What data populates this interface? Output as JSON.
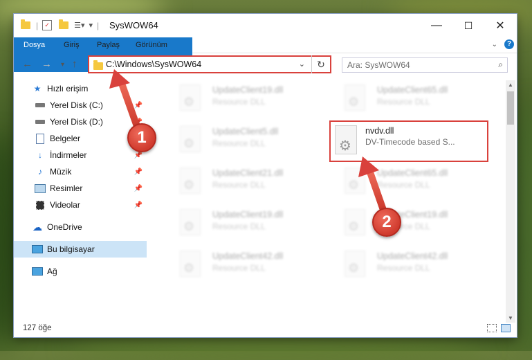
{
  "window": {
    "title": "SysWOW64",
    "minimize": "—",
    "maximize": "☐",
    "close": "✕"
  },
  "ribbon": {
    "tabs": [
      "Dosya",
      "Giriş",
      "Paylaş",
      "Görünüm"
    ],
    "help": "?"
  },
  "address": {
    "path": "C:\\Windows\\SysWOW64",
    "search_placeholder": "Ara: SysWOW64"
  },
  "sidebar": {
    "items": [
      {
        "label": "Hızlı erişim",
        "icon": "star-icon",
        "pinned": false
      },
      {
        "label": "Yerel Disk (C:)",
        "icon": "drive-icon",
        "pinned": true
      },
      {
        "label": "Yerel Disk (D:)",
        "icon": "drive-icon",
        "pinned": true
      },
      {
        "label": "Belgeler",
        "icon": "documents-icon",
        "pinned": true
      },
      {
        "label": "İndirmeler",
        "icon": "download-icon",
        "pinned": true
      },
      {
        "label": "Müzik",
        "icon": "music-icon",
        "pinned": true
      },
      {
        "label": "Resimler",
        "icon": "pictures-icon",
        "pinned": true
      },
      {
        "label": "Videolar",
        "icon": "videos-icon",
        "pinned": true
      },
      {
        "label": "OneDrive",
        "icon": "cloud-icon",
        "pinned": false
      },
      {
        "label": "Bu bilgisayar",
        "icon": "computer-icon",
        "pinned": false,
        "selected": true
      },
      {
        "label": "Ağ",
        "icon": "network-icon",
        "pinned": false
      }
    ]
  },
  "files": {
    "left": [
      {
        "name": "UpdateClient19.dll",
        "desc": "Resource DLL"
      },
      {
        "name": "UpdateClient5.dll",
        "desc": "Resource DLL"
      },
      {
        "name": "UpdateClient21.dll",
        "desc": "Resource DLL"
      },
      {
        "name": "UpdateClient19.dll",
        "desc": "Resource DLL"
      },
      {
        "name": "UpdateClient42.dll",
        "desc": "Resource DLL"
      }
    ],
    "right": [
      {
        "name": "UpdateClient65.dll",
        "desc": "Resource DLL"
      },
      {
        "name": "nvdv.dll",
        "desc": "DV-Timecode based S..."
      },
      {
        "name": "UpdateClient65.dll",
        "desc": "Resource DLL"
      },
      {
        "name": "UpdateClient19.dll",
        "desc": "Resource DLL"
      },
      {
        "name": "UpdateClient42.dll",
        "desc": "Resource DLL"
      }
    ]
  },
  "status": {
    "count": "127 öğe"
  },
  "annotations": {
    "step1": "1",
    "step2": "2",
    "color": "#d9413c"
  }
}
